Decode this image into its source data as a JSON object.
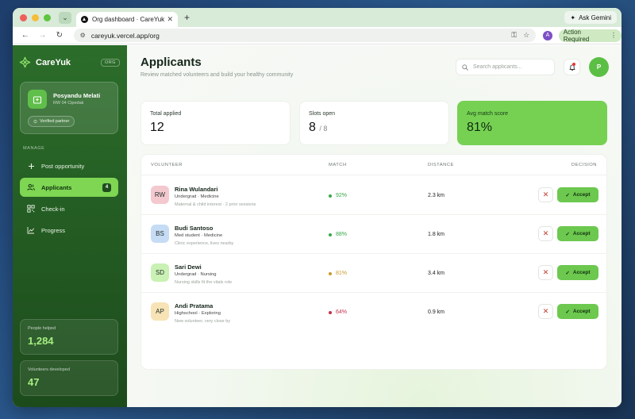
{
  "browser": {
    "tab_title": "Org dashboard · CareYuk",
    "url": "careyuk.vercel.app/org",
    "ask_gemini": "Ask Gemini",
    "profile_initial": "A",
    "action_required": "Action Required"
  },
  "sidebar": {
    "brand": "CareYuk",
    "badge": "ORG",
    "org_name": "Posyandu Melati",
    "org_location": "RW 04 Cipedak",
    "verified": "Verified partner",
    "manage_label": "MANAGE",
    "items": [
      {
        "label": "Post opportunity",
        "icon": "plus-icon"
      },
      {
        "label": "Applicants",
        "icon": "users-icon",
        "count": "4",
        "active": true
      },
      {
        "label": "Check-in",
        "icon": "qr-code-icon"
      },
      {
        "label": "Progress",
        "icon": "chart-icon"
      }
    ],
    "stats": [
      {
        "label": "People helped",
        "value": "1,284"
      },
      {
        "label": "Volunteers developed",
        "value": "47"
      }
    ]
  },
  "main": {
    "title": "Applicants",
    "subtitle": "Review matched volunteers and build your healthy community",
    "search_placeholder": "Search applicants...",
    "avatar_initial": "P",
    "kpis": [
      {
        "label": "Total applied",
        "value": "12",
        "sub": ""
      },
      {
        "label": "Slots open",
        "value": "8",
        "sub": "/ 8"
      },
      {
        "label": "Avg match score",
        "value": "81%",
        "sub": ""
      }
    ],
    "table": {
      "headers": [
        "VOLUNTEER",
        "MATCH",
        "DISTANCE",
        "DECISION"
      ],
      "accept_label": "Accept",
      "rows": [
        {
          "initials": "RW",
          "name": "Rina Wulandari",
          "meta": "Undergrad · Medicine",
          "note": "Maternal & child interest · 2 prior sessions",
          "match": "92%",
          "distance": "2.3 km",
          "avatar_color": "#f3c8cf",
          "match_color": "#3aa84a"
        },
        {
          "initials": "BS",
          "name": "Budi Santoso",
          "meta": "Med student · Medicine",
          "note": "Clinic experience, lives nearby",
          "match": "88%",
          "distance": "1.8 km",
          "avatar_color": "#c6dcf5",
          "match_color": "#3aa84a"
        },
        {
          "initials": "SD",
          "name": "Sari Dewi",
          "meta": "Undergrad · Nursing",
          "note": "Nursing skills fit the vitals role",
          "match": "81%",
          "distance": "3.4 km",
          "avatar_color": "#c9f1b4",
          "match_color": "#c99a2e"
        },
        {
          "initials": "AP",
          "name": "Andi Pratama",
          "meta": "Highschool · Exploring",
          "note": "New volunteer, very close by",
          "match": "64%",
          "distance": "0.9 km",
          "avatar_color": "#f7e3b5",
          "match_color": "#c2334a"
        }
      ]
    }
  },
  "colors": {
    "sidebar_green": "#2c6d2a",
    "accent_green": "#76d153",
    "active_nav": "#7ed653"
  }
}
